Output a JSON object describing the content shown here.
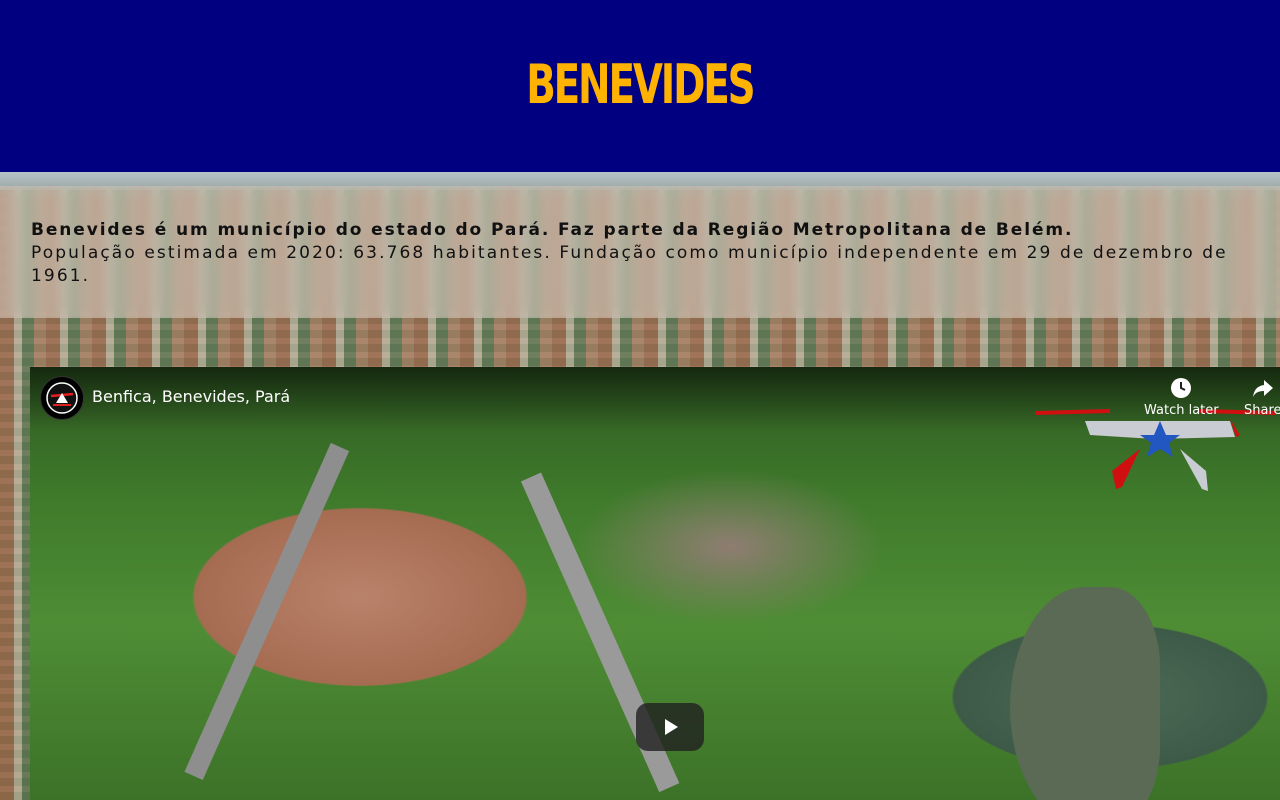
{
  "header": {
    "title": "BENEVIDES",
    "background_color": "#000080",
    "title_color": "#ffb300"
  },
  "intro": {
    "lead": "Benevides é um município do estado do Pará. Faz parte da Região Metropolitana de Belém.",
    "body": "População estimada em 2020: 63.768 habitantes. Fundação como município independente em 29 de dezembro de 1961."
  },
  "video": {
    "title": "Benfica, Benevides, Pará",
    "watch_later_label": "Watch later",
    "share_label": "Share",
    "icons": {
      "watch_later": "clock-icon",
      "share": "share-arrow-icon",
      "play": "play-icon",
      "channel": "channel-avatar"
    }
  }
}
